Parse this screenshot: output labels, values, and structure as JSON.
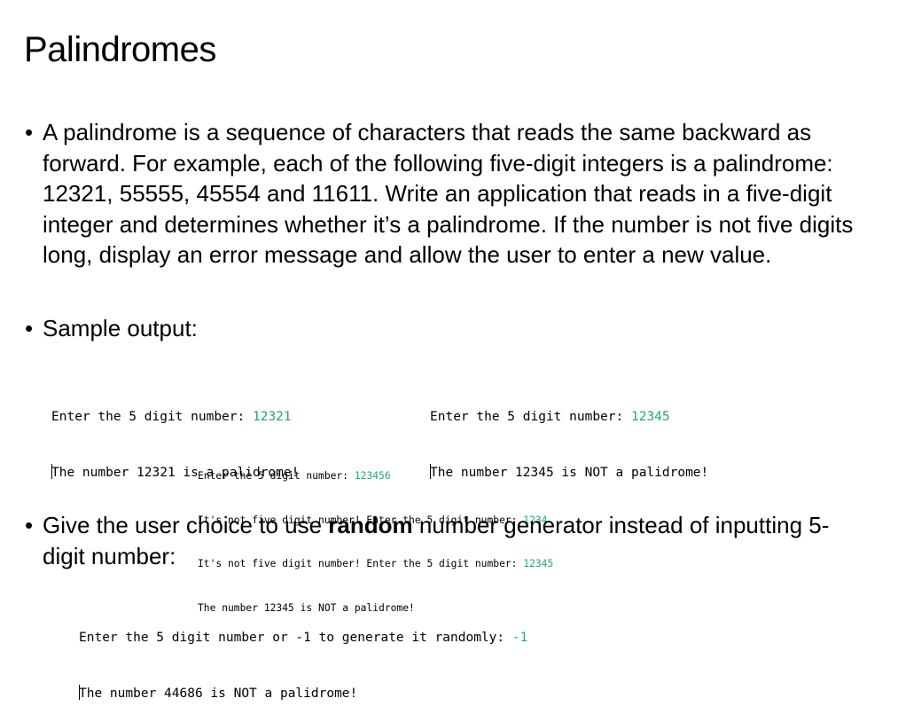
{
  "title": "Palindromes",
  "bullets": {
    "marker": "•",
    "b1": "A palindrome is a sequence of characters that reads the same backward as forward. For example, each of the following five-digit integers is a palindrome: 12321, 55555, 45554 and 11611. Write an application that reads in a five-digit integer and determines whether it’s a palindrome. If the number is not five digits long, display an error message and allow the user to enter a new value.",
    "b2": "Sample output:",
    "b3_before": "Give the user choice to use ",
    "b3_bold": "random",
    "b3_after": " number generator instead of inputting 5-digit number:"
  },
  "console1": {
    "prompt": "Enter the 5 digit number: ",
    "input": "12321",
    "result": "The number 12321 is a palidrome!"
  },
  "console2": {
    "prompt": "Enter the 5 digit number: ",
    "input": "12345",
    "result": "The number 12345 is NOT a palidrome!"
  },
  "console3": {
    "l1_prompt": "Enter the 5 digit number: ",
    "l1_input": "123456",
    "l2_prompt": "It's not five digit number! Enter the 5 digit number: ",
    "l2_input": "1234",
    "l3_prompt": "It's not five digit number! Enter the 5 digit number: ",
    "l3_input": "12345",
    "l4": "The number 12345 is NOT a palidrome!"
  },
  "console4": {
    "prompt": "Enter the 5 digit number or -1 to generate it randomly: ",
    "input": "-1",
    "result": "The number 44686 is NOT a palidrome!"
  },
  "colors": {
    "input_text": "#1ea77a",
    "text": "#000000",
    "background": "#ffffff"
  }
}
